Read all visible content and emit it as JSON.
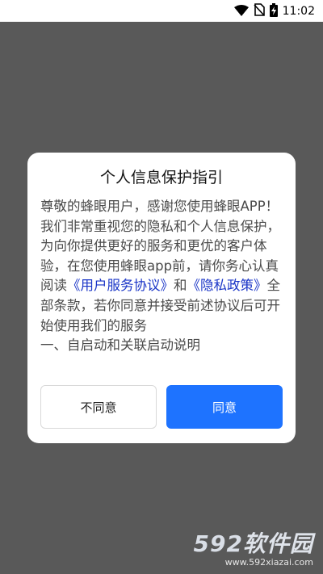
{
  "status_bar": {
    "time": "11:02",
    "icons": [
      "wifi-icon",
      "no-sim-icon",
      "battery-charging-icon"
    ]
  },
  "dialog": {
    "title": "个人信息保护指引",
    "body": {
      "intro": "尊敬的蜂眼用户，感谢您使用蜂眼APP！我们非常重视您的隐私和个人信息保护，为向你提供更好的服务和更优的客户体验，在您使用蜂眼app前，请你务心认真阅读",
      "link_user_agreement": "《用户服务协议》",
      "connector": "和",
      "link_privacy_policy": "《隐私政策》",
      "outro": "全部条款，若你同意并接受前述协议后可开始使用我们的服务",
      "section_heading": "一、自启动和关联启动说明"
    },
    "buttons": {
      "disagree": "不同意",
      "agree": "同意"
    }
  },
  "watermark": {
    "logo_number": "592",
    "logo_text": "软件园",
    "url": "www.592xiazai.com"
  },
  "colors": {
    "overlay": "#595959",
    "agree_button": "#1e73ff",
    "link": "#1a35c7"
  }
}
